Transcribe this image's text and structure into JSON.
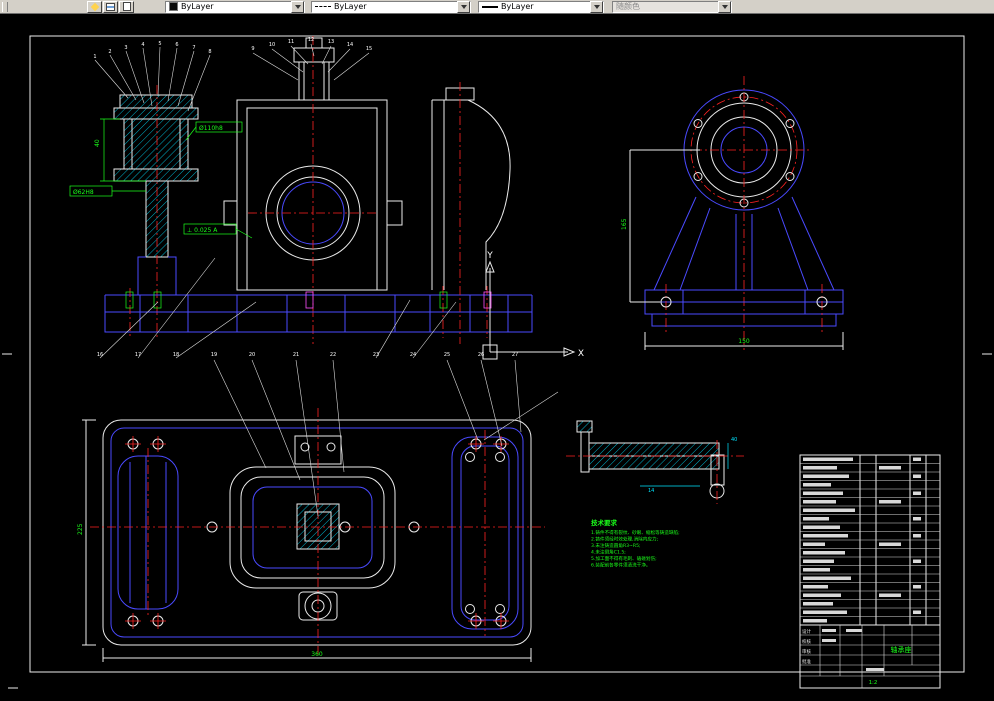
{
  "toolbar": {
    "color_value": "ByLayer",
    "linetype_value": "ByLayer",
    "lineweight_value": "ByLayer",
    "plotstyle_value": "随颜色"
  },
  "axis": {
    "x": "X",
    "y": "Y"
  },
  "gdt": {
    "frame1": "Ø62H8",
    "frame2": "Ø110h8",
    "frame3": "⊥ 0.025 A"
  },
  "dims": {
    "left_h": "40",
    "end_left": "165",
    "end_bottom": "150",
    "plan_bottom": "360",
    "plan_left": "225",
    "detail_a": "40",
    "detail_b": "14"
  },
  "balloons": [
    "1",
    "2",
    "3",
    "4",
    "5",
    "6",
    "7",
    "8",
    "9",
    "10",
    "11",
    "12",
    "13",
    "14",
    "15",
    "16",
    "17",
    "18",
    "19",
    "20",
    "21",
    "22",
    "23",
    "24",
    "25",
    "26",
    "27"
  ],
  "tech_requirements": {
    "title": "技术要求",
    "lines": [
      "1.铸件不得有裂纹、砂眼、缩松等铸造缺陷;",
      "2.铸件须经时效处理,消除内应力;",
      "3.未注铸造圆角R3~R5;",
      "4.未注倒角C1.5;",
      "5.加工面不得有毛刺、磕碰划伤;",
      "6.装配前各零件须清洗干净。"
    ]
  },
  "title_block": {
    "part_name": "轴承座",
    "scale": "1:2",
    "labels": [
      "设计",
      "校核",
      "审核",
      "批准"
    ]
  }
}
